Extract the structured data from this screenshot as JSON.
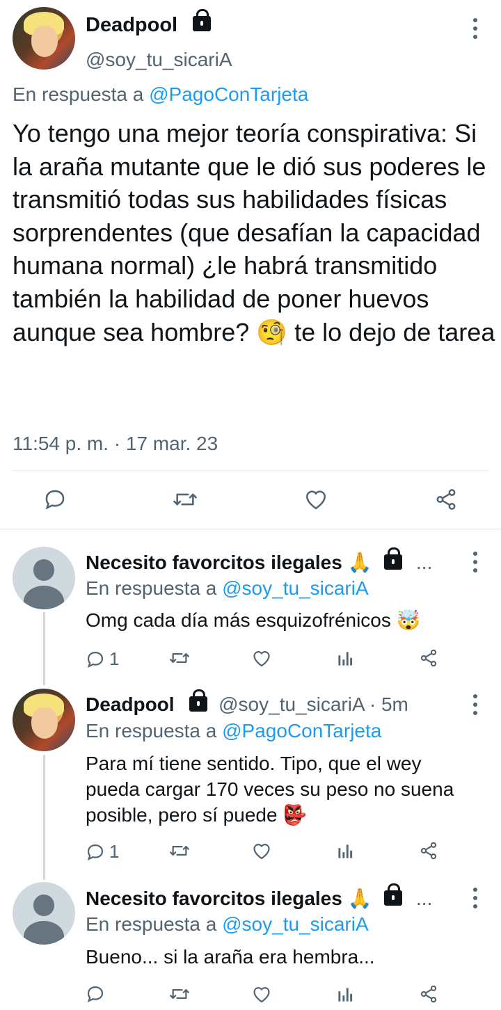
{
  "main_tweet": {
    "author_name": "Deadpool",
    "author_handle": "@soy_tu_sicariA",
    "reply_prefix": "En respuesta a",
    "reply_target": "@PagoConTarjeta",
    "text_before_emoji": "Yo tengo una mejor teoría conspirativa: Si la araña mutante que le dió sus poderes le transmitió todas sus habilidades físicas sorprendentes (que desafían la capacidad humana normal)  ¿le habrá transmitido también la habilidad de poner huevos aunque sea hombre?",
    "emoji": "🧐",
    "text_after_emoji": "te lo dejo de tarea",
    "timestamp": "11:54 p. m. · 17 mar. 23"
  },
  "replies": [
    {
      "author_name": "Necesito favorcitos ilegales 🙏",
      "ellipsis": "...",
      "reply_prefix": "En respuesta a",
      "reply_target": "@soy_tu_sicariA",
      "text": "Omg cada día más esquizofrénicos 🤯",
      "reply_count": "1"
    },
    {
      "author_name": "Deadpool",
      "author_handle": "@soy_tu_sicariA · 5m",
      "reply_prefix": "En respuesta a",
      "reply_target": "@PagoConTarjeta",
      "text": "Para mí tiene sentido. Tipo, que el wey pueda cargar 170 veces su peso no suena posible, pero sí puede 👺",
      "reply_count": "1"
    },
    {
      "author_name": "Necesito favorcitos ilegales 🙏",
      "ellipsis": "...",
      "reply_prefix": "En respuesta a",
      "reply_target": "@soy_tu_sicariA",
      "text": "Bueno... si la araña era hembra...",
      "reply_count": ""
    }
  ],
  "colors": {
    "link": "#1d9bf0",
    "secondary_text": "#536471",
    "primary_text": "#0f1419"
  },
  "icons": [
    "lock-icon",
    "more-icon",
    "reply-icon",
    "retweet-icon",
    "like-icon",
    "share-icon",
    "views-icon"
  ]
}
